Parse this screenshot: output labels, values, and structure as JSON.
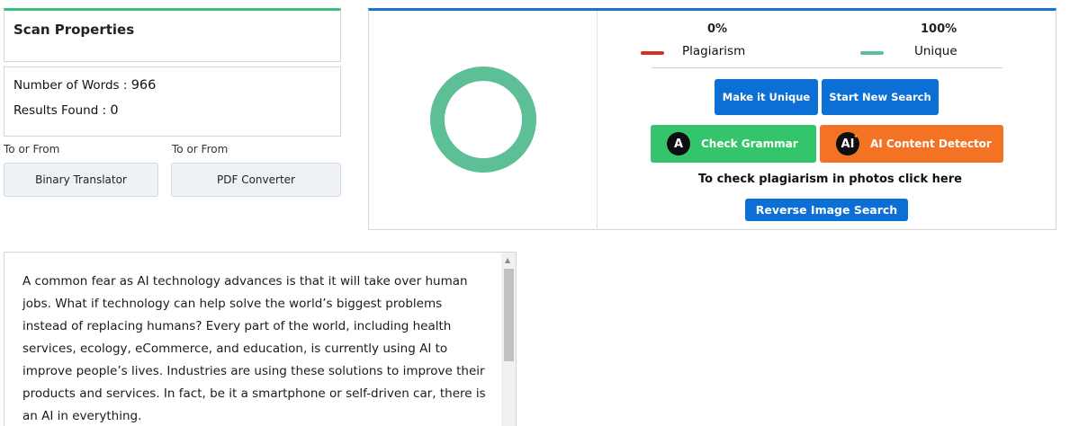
{
  "scan": {
    "title": "Scan Properties",
    "words_label": "Number of Words : ",
    "words_value": "966",
    "results_label": "Results Found : ",
    "results_value": "0"
  },
  "tools": {
    "left_caption": "To or From",
    "right_caption": "To or From",
    "binary_label": "Binary Translator",
    "pdf_label": "PDF Converter"
  },
  "result": {
    "plagiarism_percent": "0%",
    "unique_percent": "100%",
    "plagiarism_label": "Plagiarism",
    "unique_label": "Unique",
    "plagiarism_fraction": 0,
    "unique_fraction": 1,
    "colors": {
      "plagiarism": "#d93025",
      "unique": "#5cbf95"
    }
  },
  "actions": {
    "make_unique": "Make it Unique",
    "start_new": "Start New Search",
    "check_grammar": "Check Grammar",
    "grammar_icon": "A",
    "ai_detector": "AI Content Detector",
    "ai_icon": "AI",
    "photo_prompt": "To check plagiarism in photos click here",
    "reverse_image": "Reverse Image Search"
  },
  "text": "A common fear as AI technology advances is that it will take over human jobs. What if technology can help solve the world’s biggest problems instead of replacing humans? Every part of the world, including health services, ecology, eCommerce, and education, is currently using AI to improve people’s lives. Industries are using these solutions to improve their products and services. In fact, be it a smartphone or self-driven car, there is an AI in everything."
}
